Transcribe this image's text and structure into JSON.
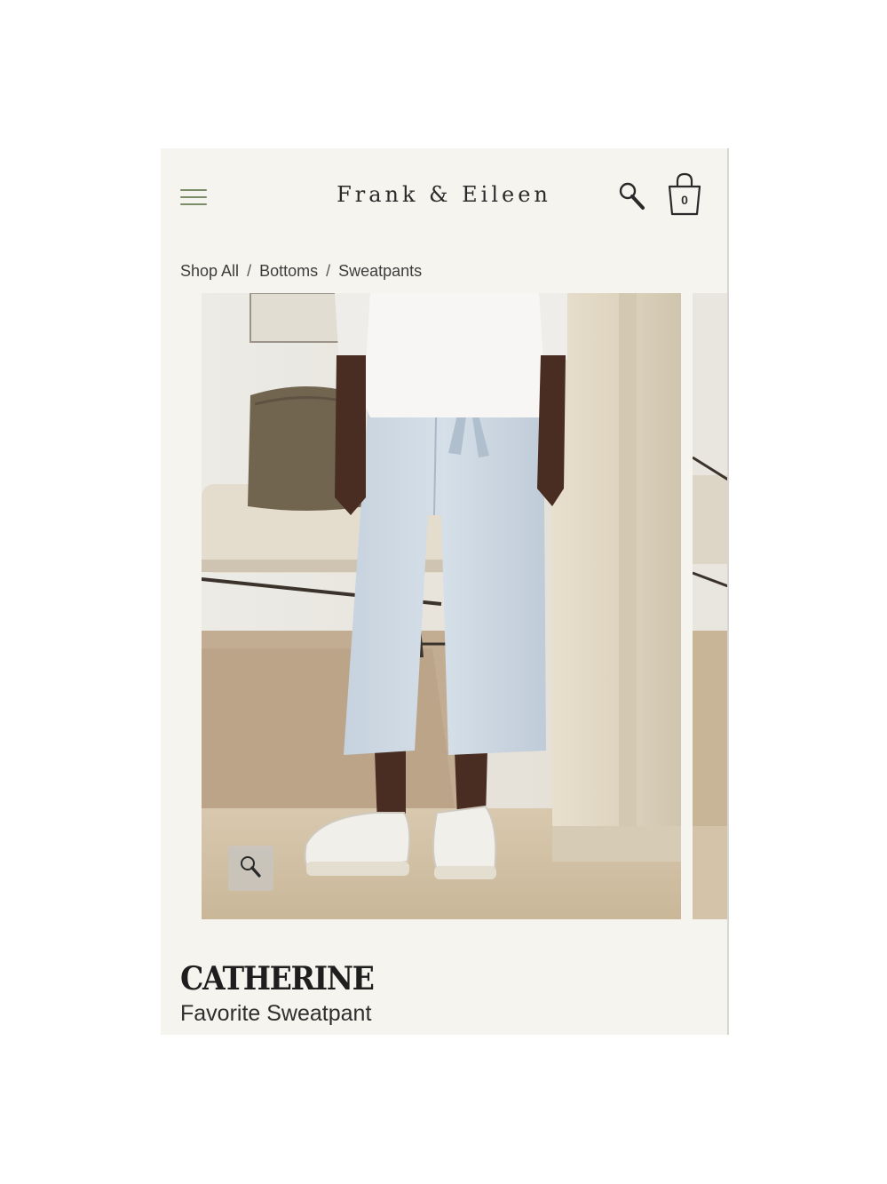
{
  "header": {
    "brand": "Frank & Eileen",
    "cart_count": "0",
    "icons": {
      "menu": "hamburger-menu-icon",
      "search": "search-icon",
      "bag": "shopping-bag-icon"
    },
    "accent_color": "#7c8c67"
  },
  "breadcrumb": {
    "items": [
      "Shop All",
      "Bottoms",
      "Sweatpants"
    ],
    "separator": "/"
  },
  "gallery": {
    "zoom_icon": "magnifier-icon"
  },
  "product": {
    "name": "CATHERINE",
    "subtitle": "Favorite Sweatpant",
    "color": "light blue"
  }
}
